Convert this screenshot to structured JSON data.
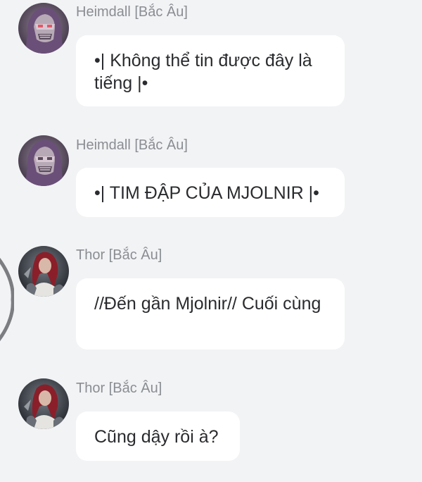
{
  "messages": [
    {
      "sender": "Heimdall [Bắc Âu]",
      "text": "•| Không thể tin được đây là tiếng |•",
      "avatar": "heimdall-avatar"
    },
    {
      "sender": "Heimdall [Bắc Âu]",
      "text": "•| TIM ĐẬP CỦA MJOLNIR |•",
      "avatar": "heimdall-avatar"
    },
    {
      "sender": "Thor [Bắc Âu]",
      "text": "//Đến gần Mjolnir// Cuối cùng",
      "avatar": "thor-avatar"
    },
    {
      "sender": "Thor [Bắc Âu]",
      "text": "Cũng dậy rồi à?",
      "avatar": "thor-avatar"
    }
  ],
  "colors": {
    "background": "#f2f3f5",
    "bubble": "#ffffff",
    "sender_text": "#8a8d92",
    "message_text": "#2a2b2e"
  }
}
